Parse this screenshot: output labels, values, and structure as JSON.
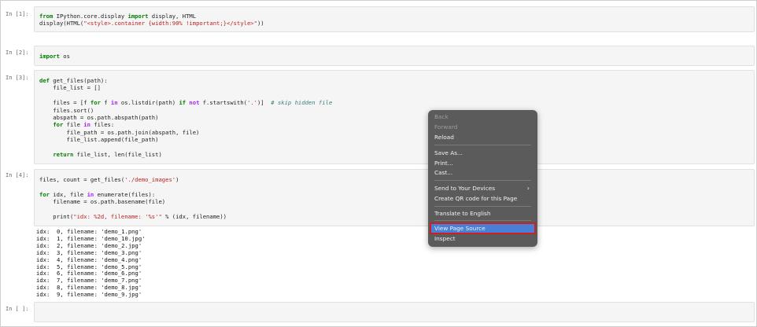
{
  "cells": [
    {
      "prompt": "In [1]:",
      "code_lines": [
        [
          {
            "t": "from",
            "c": "kw"
          },
          {
            "t": " IPython.core.display "
          },
          {
            "t": "import",
            "c": "kw"
          },
          {
            "t": " display, HTML"
          }
        ],
        [
          {
            "t": "display(HTML("
          },
          {
            "t": "\"<style>.container {width:90% !important;}</style>\"",
            "c": "str"
          },
          {
            "t": "))"
          }
        ]
      ]
    },
    {
      "prompt": "In [2]:",
      "code_lines": [
        [
          {
            "t": "import",
            "c": "kw"
          },
          {
            "t": " os"
          }
        ]
      ]
    },
    {
      "prompt": "In [3]:",
      "code_lines": [
        [
          {
            "t": "def",
            "c": "kw"
          },
          {
            "t": " get_files(path):"
          }
        ],
        [
          {
            "t": "    file_list = []"
          }
        ],
        [
          {
            "t": ""
          }
        ],
        [
          {
            "t": "    files = [f "
          },
          {
            "t": "for",
            "c": "kw"
          },
          {
            "t": " f "
          },
          {
            "t": "in",
            "c": "op"
          },
          {
            "t": " os.listdir(path) "
          },
          {
            "t": "if",
            "c": "kw"
          },
          {
            "t": " "
          },
          {
            "t": "not",
            "c": "op"
          },
          {
            "t": " f.startswith("
          },
          {
            "t": "'.'",
            "c": "str"
          },
          {
            "t": ")]  "
          },
          {
            "t": "# skip hidden file",
            "c": "cm"
          }
        ],
        [
          {
            "t": "    files.sort()"
          }
        ],
        [
          {
            "t": "    abspath = os.path.abspath(path)"
          }
        ],
        [
          {
            "t": "    "
          },
          {
            "t": "for",
            "c": "kw"
          },
          {
            "t": " file "
          },
          {
            "t": "in",
            "c": "op"
          },
          {
            "t": " files:"
          }
        ],
        [
          {
            "t": "        file_path = os.path.join(abspath, file)"
          }
        ],
        [
          {
            "t": "        file_list.append(file_path)"
          }
        ],
        [
          {
            "t": ""
          }
        ],
        [
          {
            "t": "    "
          },
          {
            "t": "return",
            "c": "kw"
          },
          {
            "t": " file_list, len(file_list)"
          }
        ]
      ]
    },
    {
      "prompt": "In [4]:",
      "code_lines": [
        [
          {
            "t": "files, count = get_files("
          },
          {
            "t": "'./demo_images'",
            "c": "str"
          },
          {
            "t": ")"
          }
        ],
        [
          {
            "t": ""
          }
        ],
        [
          {
            "t": "for",
            "c": "kw"
          },
          {
            "t": " idx, file "
          },
          {
            "t": "in",
            "c": "op"
          },
          {
            "t": " enumerate(files):"
          }
        ],
        [
          {
            "t": "    filename = os.path.basename(file)"
          }
        ],
        [
          {
            "t": ""
          }
        ],
        [
          {
            "t": "    print("
          },
          {
            "t": "\"idx: %2d, filename: '%s'\"",
            "c": "str"
          },
          {
            "t": " % (idx, filename))"
          }
        ]
      ],
      "output_lines": [
        "idx:  0, filename: 'demo_1.png'",
        "idx:  1, filename: 'demo_10.jpg'",
        "idx:  2, filename: 'demo_2.jpg'",
        "idx:  3, filename: 'demo_3.png'",
        "idx:  4, filename: 'demo_4.png'",
        "idx:  5, filename: 'demo_5.png'",
        "idx:  6, filename: 'demo_6.png'",
        "idx:  7, filename: 'demo_7.png'",
        "idx:  8, filename: 'demo_8.jpg'",
        "idx:  9, filename: 'demo_9.jpg'"
      ]
    },
    {
      "prompt": "In [ ]:",
      "code_lines": []
    }
  ],
  "context_menu": {
    "back": "Back",
    "forward": "Forward",
    "reload": "Reload",
    "save_as": "Save As...",
    "print": "Print...",
    "cast": "Cast...",
    "send_to_devices": "Send to Your Devices",
    "submenu_arrow": "›",
    "qr_code": "Create QR code for this Page",
    "translate": "Translate to English",
    "view_source": "View Page Source",
    "inspect": "Inspect"
  },
  "colors": {
    "highlight": "#4a7fd6",
    "highlight_border": "#cc1f1f",
    "menu_bg": "#5b5b5b"
  }
}
